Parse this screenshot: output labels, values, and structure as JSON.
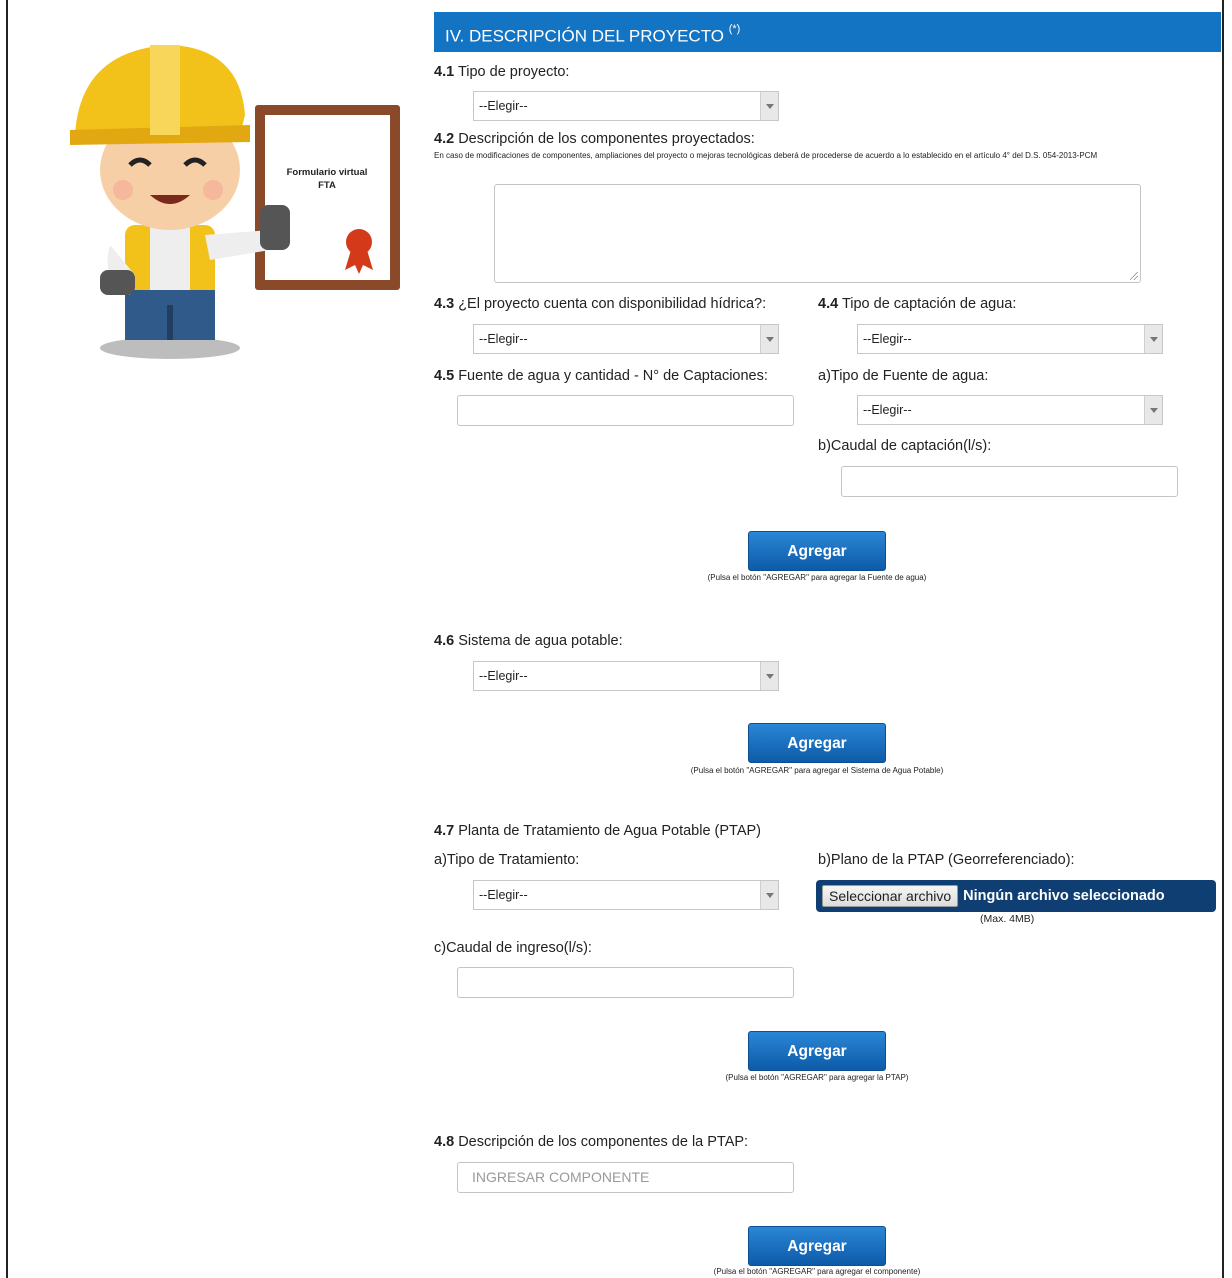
{
  "section": {
    "title": "IV. DESCRIPCIÓN DEL PROYECTO",
    "marker": "(*)"
  },
  "illustration": {
    "certificate_text_line1": "Formulario virtual",
    "certificate_text_line2": "FTA"
  },
  "q41": {
    "number": "4.1",
    "label": "Tipo de proyecto:",
    "select_value": "--Elegir--"
  },
  "q42": {
    "number": "4.2",
    "label": "Descripción de los componentes proyectados:",
    "note": "En caso de modificaciones de componentes, ampliaciones del proyecto o mejoras tecnológicas deberá de procederse de acuerdo a lo establecido en el artículo 4° del D.S. 054-2013-PCM"
  },
  "q43": {
    "number": "4.3",
    "label": "¿El proyecto cuenta con disponibilidad hídrica?:",
    "select_value": "--Elegir--"
  },
  "q44": {
    "number": "4.4",
    "label": "Tipo de captación de agua:",
    "select_value": "--Elegir--"
  },
  "q45": {
    "number": "4.5",
    "label": "Fuente de agua y cantidad - N° de Captaciones:",
    "sub_a_label": "a)Tipo de Fuente de agua:",
    "sub_a_select": "--Elegir--",
    "sub_b_label": "b)Caudal de captación(l/s):"
  },
  "add1": {
    "label": "Agregar",
    "hint": "(Pulsa el botón \"AGREGAR\" para agregar la Fuente de agua)"
  },
  "q46": {
    "number": "4.6",
    "label": "Sistema de agua potable:",
    "select_value": "--Elegir--"
  },
  "add2": {
    "label": "Agregar",
    "hint": "(Pulsa el botón \"AGREGAR\" para agregar el Sistema de Agua Potable)"
  },
  "q47": {
    "number": "4.7",
    "label": "Planta de Tratamiento de Agua Potable (PTAP)",
    "sub_a_label": "a)Tipo de Tratamiento:",
    "sub_a_select": "--Elegir--",
    "sub_b_label": "b)Plano de la PTAP (Georreferenciado):",
    "file_button": "Seleccionar archivo",
    "file_status": "Ningún archivo seleccionado",
    "file_max": "(Max. 4MB)",
    "sub_c_label": "c)Caudal de ingreso(l/s):"
  },
  "add3": {
    "label": "Agregar",
    "hint": "(Pulsa el botón \"AGREGAR\" para agregar la PTAP)"
  },
  "q48": {
    "number": "4.8",
    "label": "Descripción de los componentes de la PTAP:",
    "placeholder": "INGRESAR COMPONENTE"
  },
  "add4": {
    "label": "Agregar",
    "hint": "(Pulsa el botón \"AGREGAR\" para agregar el componente)"
  }
}
